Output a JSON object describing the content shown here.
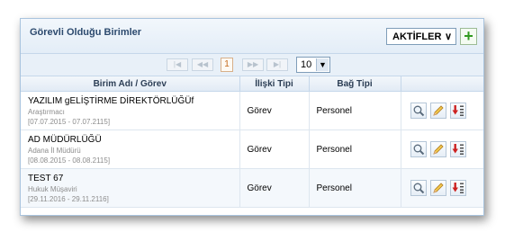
{
  "panel": {
    "title": "Görevli Olduğu Birimler",
    "filter_value": "AKTİFLER",
    "add_label": "+"
  },
  "pager": {
    "first": "|◀",
    "prev": "◀◀",
    "current_page": "1",
    "next": "▶▶",
    "last": "▶|",
    "page_size": "10"
  },
  "table": {
    "headers": [
      "Birim Adı / Görev",
      "İlişki Tipi",
      "Bağ Tipi",
      ""
    ],
    "rows": [
      {
        "name": "YAZILIM gELİŞTİRME DİREKTÖRLÜĞÜf",
        "role": "Araştırmacı",
        "dates": "[07.07.2015 - 07.07.2115]",
        "relation": "Görev",
        "bond": "Personel"
      },
      {
        "name": "AD MÜDÜRLÜĞÜ",
        "role": "Adana İl Müdürü",
        "dates": "[08.08.2015 - 08.08.2115]",
        "relation": "Görev",
        "bond": "Personel"
      },
      {
        "name": "TEST 67",
        "role": "Hukuk Müşaviri",
        "dates": "[29.11.2016 - 29.11.2116]",
        "relation": "Görev",
        "bond": "Personel"
      }
    ]
  },
  "icons": {
    "view": "magnifier-icon",
    "edit": "pencil-icon",
    "delete": "delete-down-icon"
  },
  "colors": {
    "border": "#a9c4de",
    "title": "#2c4a6e",
    "add_green": "#2f9a1f",
    "current_page": "#c46a1c",
    "delete_red": "#cc2222"
  }
}
